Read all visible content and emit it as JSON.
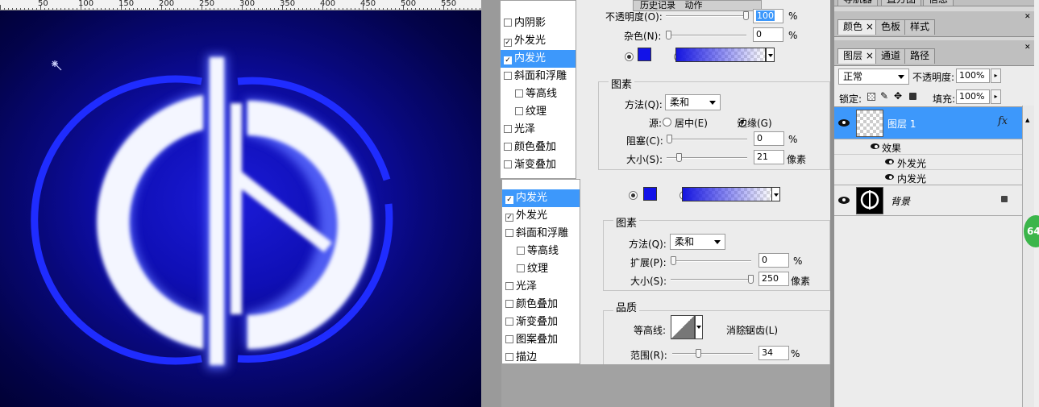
{
  "ruler": {
    "labels": [
      "50",
      "100",
      "150",
      "200",
      "250",
      "300",
      "350",
      "400",
      "450",
      "500",
      "550"
    ]
  },
  "dialog_top": {
    "styles": [
      {
        "label": "内阴影",
        "checked": false
      },
      {
        "label": "外发光",
        "checked": true
      },
      {
        "label": "内发光",
        "checked": true,
        "selected": true
      },
      {
        "label": "斜面和浮雕",
        "checked": false
      },
      {
        "label": "等高线",
        "checked": false,
        "indent": true
      },
      {
        "label": "纹理",
        "checked": false,
        "indent": true
      },
      {
        "label": "光泽",
        "checked": false
      },
      {
        "label": "颜色叠加",
        "checked": false
      },
      {
        "label": "渐变叠加",
        "checked": false
      }
    ],
    "opacity_label": "不透明度(O):",
    "opacity_value": "100",
    "noise_label": "杂色(N):",
    "noise_value": "0",
    "percent": "%",
    "elements_title": "图素",
    "method_label": "方法(Q):",
    "method_value": "柔和",
    "source_label": "源:",
    "source_center": "居中(E)",
    "source_edge": "边缘(G)",
    "choke_label": "阻塞(C):",
    "choke_value": "0",
    "size_label": "大小(S):",
    "size_value": "21",
    "px_unit": "像素",
    "tab_history": "历史记录",
    "tab_actions": "动作"
  },
  "dialog_bottom": {
    "styles": [
      {
        "label": "内发光",
        "checked": true,
        "selected": true
      },
      {
        "label": "外发光",
        "checked": true
      },
      {
        "label": "斜面和浮雕",
        "checked": false
      },
      {
        "label": "等高线",
        "checked": false,
        "indent": true
      },
      {
        "label": "纹理",
        "checked": false,
        "indent": true
      },
      {
        "label": "光泽",
        "checked": false
      },
      {
        "label": "颜色叠加",
        "checked": false
      },
      {
        "label": "渐变叠加",
        "checked": false
      },
      {
        "label": "图案叠加",
        "checked": false
      },
      {
        "label": "描边",
        "checked": false
      }
    ],
    "elements_title": "图素",
    "method_label": "方法(Q):",
    "method_value": "柔和",
    "spread_label": "扩展(P):",
    "spread_value": "0",
    "size_label": "大小(S):",
    "size_value": "250",
    "px_unit": "像素",
    "percent": "%",
    "quality_title": "品质",
    "contour_label": "等高线:",
    "antialias_label": "消除锯齿(L)",
    "range_label": "范围(R):",
    "range_value": "34"
  },
  "right_panel": {
    "top_tabs": [
      "导航器",
      "直方图",
      "信息"
    ],
    "color_tabs": [
      "颜色",
      "色板",
      "样式"
    ],
    "layer_tabs": [
      "图层",
      "通道",
      "路径"
    ],
    "blend_mode": "正常",
    "opacity_label": "不透明度:",
    "opacity_value": "100%",
    "lock_label": "锁定:",
    "fill_label": "填充:",
    "fill_value": "100%",
    "layers": [
      {
        "name": "图层 1",
        "selected": true,
        "fx": "fx"
      },
      {
        "name": "背景",
        "locked": true
      }
    ],
    "effects_label": "效果",
    "effects": [
      "外发光",
      "内发光"
    ],
    "badge": "64"
  },
  "colors": {
    "accent": "#3d98fb",
    "glow": "#1212e8"
  }
}
